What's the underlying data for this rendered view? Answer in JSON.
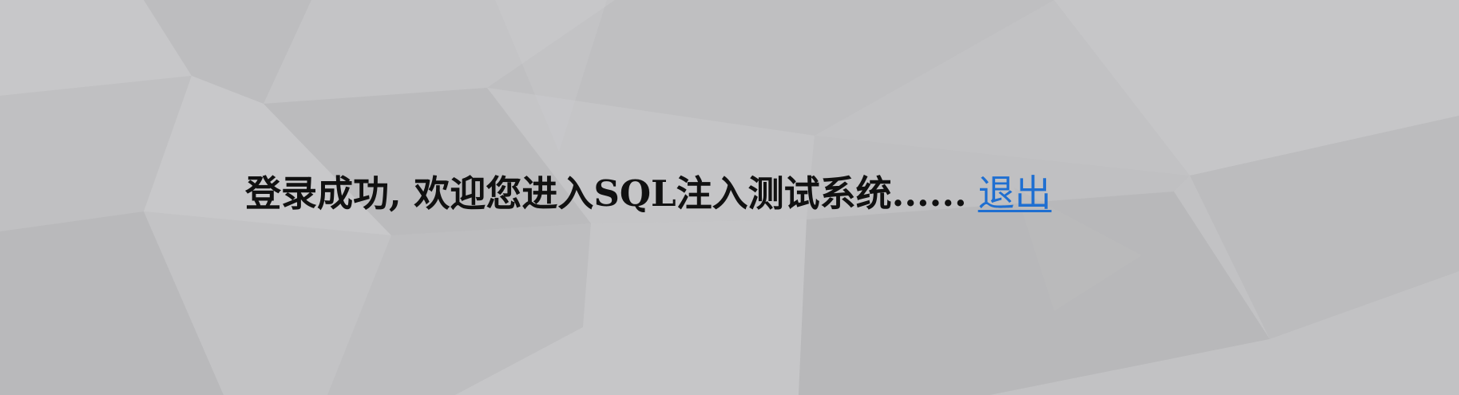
{
  "status": {
    "message": "登录成功, 欢迎您进入SQL注入测试系统......",
    "logout_link": "退出"
  },
  "theme": {
    "background": "#c2c2c4",
    "text": "#111111",
    "link": "#1f6fd1"
  }
}
